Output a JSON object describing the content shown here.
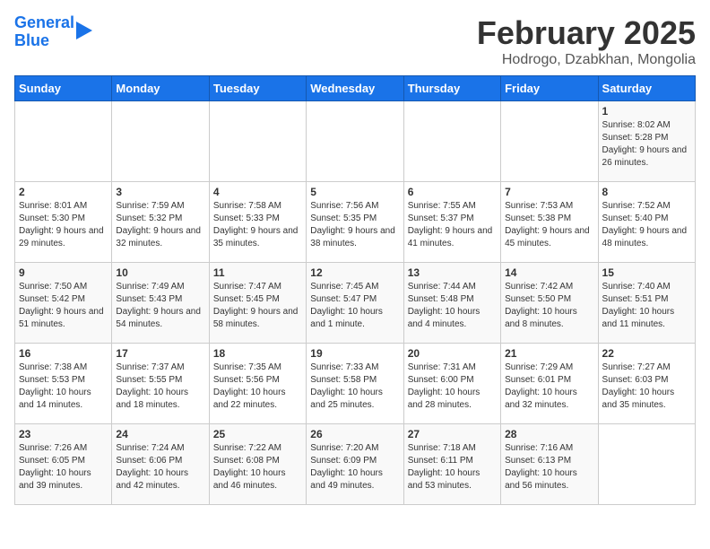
{
  "logo": {
    "line1": "General",
    "line2": "Blue"
  },
  "title": "February 2025",
  "subtitle": "Hodrogo, Dzabkhan, Mongolia",
  "weekdays": [
    "Sunday",
    "Monday",
    "Tuesday",
    "Wednesday",
    "Thursday",
    "Friday",
    "Saturday"
  ],
  "weeks": [
    [
      {
        "day": "",
        "info": ""
      },
      {
        "day": "",
        "info": ""
      },
      {
        "day": "",
        "info": ""
      },
      {
        "day": "",
        "info": ""
      },
      {
        "day": "",
        "info": ""
      },
      {
        "day": "",
        "info": ""
      },
      {
        "day": "1",
        "info": "Sunrise: 8:02 AM\nSunset: 5:28 PM\nDaylight: 9 hours and 26 minutes."
      }
    ],
    [
      {
        "day": "2",
        "info": "Sunrise: 8:01 AM\nSunset: 5:30 PM\nDaylight: 9 hours and 29 minutes."
      },
      {
        "day": "3",
        "info": "Sunrise: 7:59 AM\nSunset: 5:32 PM\nDaylight: 9 hours and 32 minutes."
      },
      {
        "day": "4",
        "info": "Sunrise: 7:58 AM\nSunset: 5:33 PM\nDaylight: 9 hours and 35 minutes."
      },
      {
        "day": "5",
        "info": "Sunrise: 7:56 AM\nSunset: 5:35 PM\nDaylight: 9 hours and 38 minutes."
      },
      {
        "day": "6",
        "info": "Sunrise: 7:55 AM\nSunset: 5:37 PM\nDaylight: 9 hours and 41 minutes."
      },
      {
        "day": "7",
        "info": "Sunrise: 7:53 AM\nSunset: 5:38 PM\nDaylight: 9 hours and 45 minutes."
      },
      {
        "day": "8",
        "info": "Sunrise: 7:52 AM\nSunset: 5:40 PM\nDaylight: 9 hours and 48 minutes."
      }
    ],
    [
      {
        "day": "9",
        "info": "Sunrise: 7:50 AM\nSunset: 5:42 PM\nDaylight: 9 hours and 51 minutes."
      },
      {
        "day": "10",
        "info": "Sunrise: 7:49 AM\nSunset: 5:43 PM\nDaylight: 9 hours and 54 minutes."
      },
      {
        "day": "11",
        "info": "Sunrise: 7:47 AM\nSunset: 5:45 PM\nDaylight: 9 hours and 58 minutes."
      },
      {
        "day": "12",
        "info": "Sunrise: 7:45 AM\nSunset: 5:47 PM\nDaylight: 10 hours and 1 minute."
      },
      {
        "day": "13",
        "info": "Sunrise: 7:44 AM\nSunset: 5:48 PM\nDaylight: 10 hours and 4 minutes."
      },
      {
        "day": "14",
        "info": "Sunrise: 7:42 AM\nSunset: 5:50 PM\nDaylight: 10 hours and 8 minutes."
      },
      {
        "day": "15",
        "info": "Sunrise: 7:40 AM\nSunset: 5:51 PM\nDaylight: 10 hours and 11 minutes."
      }
    ],
    [
      {
        "day": "16",
        "info": "Sunrise: 7:38 AM\nSunset: 5:53 PM\nDaylight: 10 hours and 14 minutes."
      },
      {
        "day": "17",
        "info": "Sunrise: 7:37 AM\nSunset: 5:55 PM\nDaylight: 10 hours and 18 minutes."
      },
      {
        "day": "18",
        "info": "Sunrise: 7:35 AM\nSunset: 5:56 PM\nDaylight: 10 hours and 22 minutes."
      },
      {
        "day": "19",
        "info": "Sunrise: 7:33 AM\nSunset: 5:58 PM\nDaylight: 10 hours and 25 minutes."
      },
      {
        "day": "20",
        "info": "Sunrise: 7:31 AM\nSunset: 6:00 PM\nDaylight: 10 hours and 28 minutes."
      },
      {
        "day": "21",
        "info": "Sunrise: 7:29 AM\nSunset: 6:01 PM\nDaylight: 10 hours and 32 minutes."
      },
      {
        "day": "22",
        "info": "Sunrise: 7:27 AM\nSunset: 6:03 PM\nDaylight: 10 hours and 35 minutes."
      }
    ],
    [
      {
        "day": "23",
        "info": "Sunrise: 7:26 AM\nSunset: 6:05 PM\nDaylight: 10 hours and 39 minutes."
      },
      {
        "day": "24",
        "info": "Sunrise: 7:24 AM\nSunset: 6:06 PM\nDaylight: 10 hours and 42 minutes."
      },
      {
        "day": "25",
        "info": "Sunrise: 7:22 AM\nSunset: 6:08 PM\nDaylight: 10 hours and 46 minutes."
      },
      {
        "day": "26",
        "info": "Sunrise: 7:20 AM\nSunset: 6:09 PM\nDaylight: 10 hours and 49 minutes."
      },
      {
        "day": "27",
        "info": "Sunrise: 7:18 AM\nSunset: 6:11 PM\nDaylight: 10 hours and 53 minutes."
      },
      {
        "day": "28",
        "info": "Sunrise: 7:16 AM\nSunset: 6:13 PM\nDaylight: 10 hours and 56 minutes."
      },
      {
        "day": "",
        "info": ""
      }
    ]
  ]
}
